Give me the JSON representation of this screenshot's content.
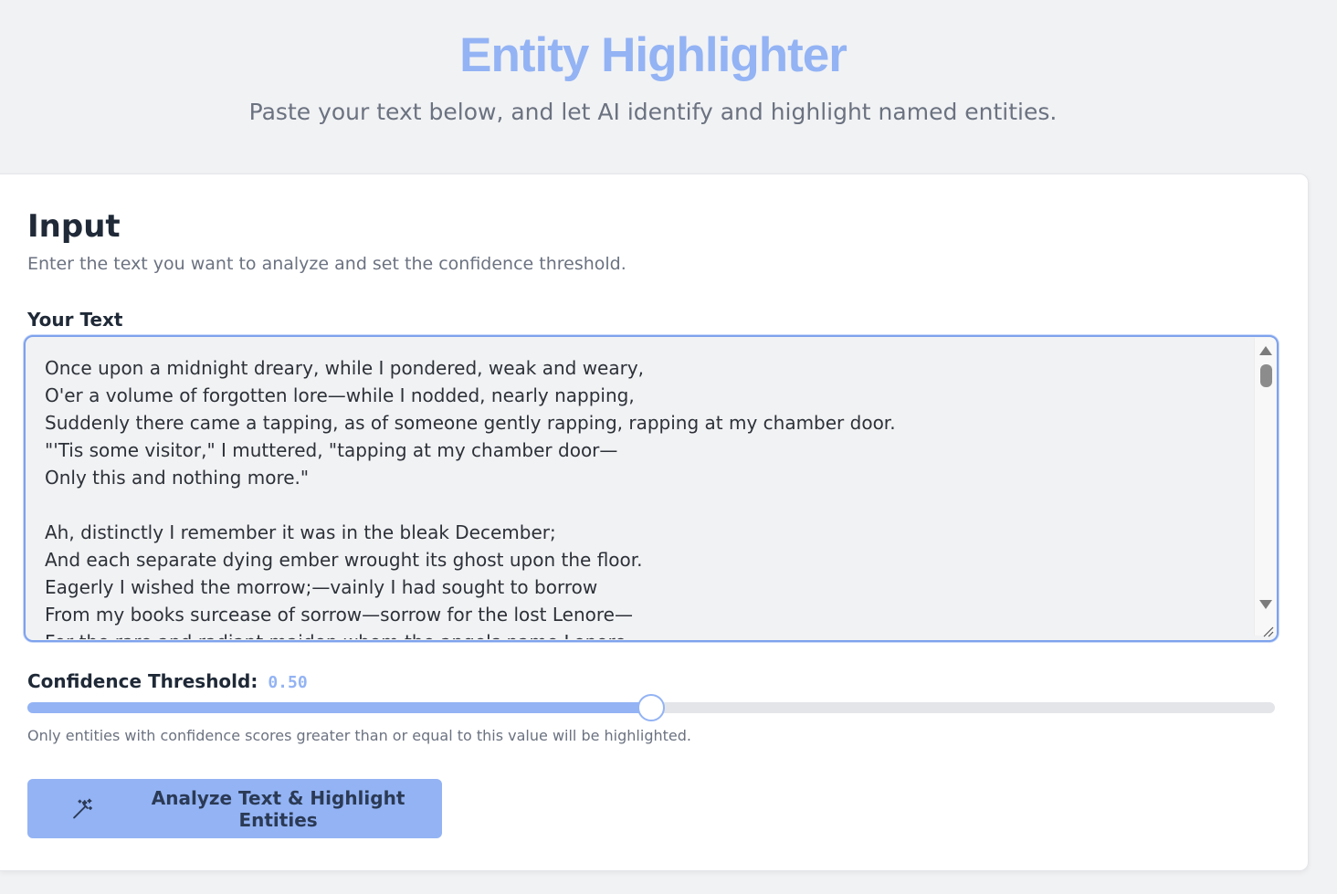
{
  "header": {
    "title": "Entity Highlighter",
    "subtitle": "Paste your text below, and let AI identify and highlight named entities."
  },
  "input_card": {
    "title": "Input",
    "description": "Enter the text you want to analyze and set the confidence threshold.",
    "text_label": "Your Text",
    "text_value": "Once upon a midnight dreary, while I pondered, weak and weary,\nO'er a volume of forgotten lore—while I nodded, nearly napping,\nSuddenly there came a tapping, as of someone gently rapping, rapping at my chamber door.\n\"'Tis some visitor,\" I muttered, \"tapping at my chamber door—\nOnly this and nothing more.\"\n\nAh, distinctly I remember it was in the bleak December;\nAnd each separate dying ember wrought its ghost upon the floor.\nEagerly I wished the morrow;—vainly I had sought to borrow\nFrom my books surcease of sorrow—sorrow for the lost Lenore—\nFor the rare and radiant maiden whom the angels name Lenore—",
    "threshold_label": "Confidence Threshold:",
    "threshold_value": "0.50",
    "threshold_fraction": 0.5,
    "threshold_help": "Only entities with confidence scores greater than or equal to this value will be highlighted.",
    "analyze_button_label": "Analyze Text & Highlight Entities",
    "analyze_button_icon": "magic-wand-icon"
  },
  "colors": {
    "accent": "#93b3f4",
    "focus_border": "#7ea2ec",
    "page_background": "#f1f2f4",
    "card_background": "#ffffff"
  }
}
